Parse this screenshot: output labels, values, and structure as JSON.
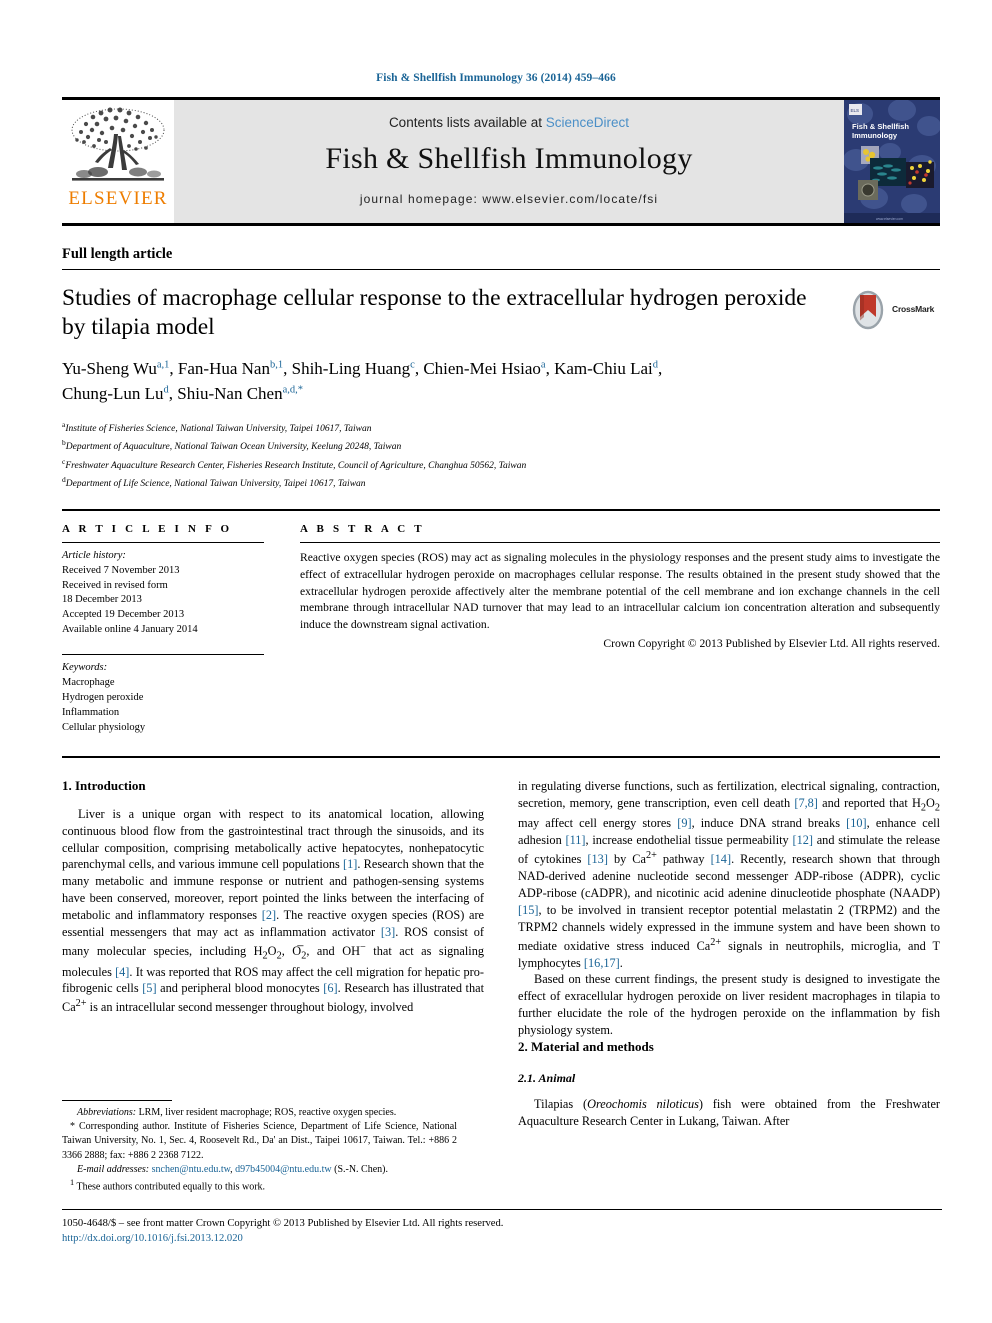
{
  "running_head": "Fish & Shellfish Immunology 36 (2014) 459–466",
  "masthead": {
    "publisher_name": "ELSEVIER",
    "contents_prefix": "Contents lists available at ",
    "sciencedirect": "ScienceDirect",
    "journal_title": "Fish & Shellfish Immunology",
    "homepage": "journal homepage: www.elsevier.com/locate/fsi",
    "cover_title_line1": "Fish & Shellfish",
    "cover_title_line2": "Immunology"
  },
  "article": {
    "type": "Full length article",
    "title": "Studies of macrophage cellular response to the extracellular hydrogen peroxide by tilapia model",
    "crossmark_label": "CrossMark",
    "authors_line1": "Yu-Sheng Wu",
    "authors": [
      {
        "name": "Yu-Sheng Wu",
        "sup": "a,1",
        "sep": ", "
      },
      {
        "name": "Fan-Hua Nan",
        "sup": "b,1",
        "sep": ", "
      },
      {
        "name": "Shih-Ling Huang",
        "sup": "c",
        "sep": ", "
      },
      {
        "name": "Chien-Mei Hsiao",
        "sup": "a",
        "sep": ", "
      },
      {
        "name": "Kam-Chiu Lai",
        "sup": "d",
        "sep": ","
      },
      {
        "name": "Chung-Lun Lu",
        "sup": "d",
        "sep": ", "
      },
      {
        "name": "Shiu-Nan Chen",
        "sup": "a,d,*",
        "sep": ""
      }
    ],
    "affiliations": [
      {
        "mark": "a",
        "text": "Institute of Fisheries Science, National Taiwan University, Taipei 10617, Taiwan"
      },
      {
        "mark": "b",
        "text": "Department of Aquaculture, National Taiwan Ocean University, Keelung 20248, Taiwan"
      },
      {
        "mark": "c",
        "text": "Freshwater Aquaculture Research Center, Fisheries Research Institute, Council of Agriculture, Changhua 50562, Taiwan"
      },
      {
        "mark": "d",
        "text": "Department of Life Science, National Taiwan University, Taipei 10617, Taiwan"
      }
    ]
  },
  "article_info": {
    "heading": "A R T I C L E   I N F O",
    "history_label": "Article history:",
    "history": [
      "Received 7 November 2013",
      "Received in revised form",
      "18 December 2013",
      "Accepted 19 December 2013",
      "Available online 4 January 2014"
    ],
    "keywords_label": "Keywords:",
    "keywords": [
      "Macrophage",
      "Hydrogen peroxide",
      "Inflammation",
      "Cellular physiology"
    ]
  },
  "abstract": {
    "heading": "A B S T R A C T",
    "text": "Reactive oxygen species (ROS) may act as signaling molecules in the physiology responses and the present study aims to investigate the effect of extracellular hydrogen peroxide on macrophages cellular response. The results obtained in the present study showed that the extracellular hydrogen peroxide affectively alter the membrane potential of the cell membrane and ion exchange channels in the cell membrane through intracellular NAD turnover that may lead to an intracellular calcium ion concentration alteration and subsequently induce the downstream signal activation.",
    "copyright": "Crown Copyright © 2013 Published by Elsevier Ltd. All rights reserved."
  },
  "body": {
    "intro_heading": "1. Introduction",
    "intro_p1_a": "Liver is a unique organ with respect to its anatomical location, allowing continuous blood flow from the gastrointestinal tract through the sinusoids, and its cellular composition, comprising metabolically active hepatocytes, nonhepatocytic parenchymal cells, and various immune cell populations ",
    "ref1": "[1]",
    "intro_p1_b": ". Research shown that the many metabolic and immune response or nutrient and pathogen-sensing systems have been conserved, moreover, report pointed the links between the interfacing of metabolic and inflammatory responses ",
    "ref2": "[2]",
    "intro_p1_c": ". The reactive oxygen species (ROS) are essential messengers that may act as inflammation activator ",
    "ref3": "[3]",
    "intro_p1_d": ". ROS consist of many molecular species, including H2O2, O2−, and OH− that act as signaling molecules ",
    "ref4": "[4]",
    "intro_p1_e": ". It was reported that ROS may affect the cell migration for hepatic pro-fibrogenic cells ",
    "ref5": "[5]",
    "intro_p1_f": " and peripheral blood monocytes ",
    "ref6": "[6]",
    "intro_p1_g": ". Research has illustrated that Ca2+ is an intracellular second messenger throughout biology, involved in regulating diverse functions, such as fertilization, electrical signaling, contraction, secretion, memory, gene transcription, even cell death ",
    "ref78": "[7,8]",
    "intro_p1_h": " and reported that H2O2 may affect cell energy stores ",
    "ref9": "[9]",
    "intro_p1_i": ", induce DNA strand breaks ",
    "ref10": "[10]",
    "intro_p1_j": ", enhance cell adhesion ",
    "ref11": "[11]",
    "intro_p1_k": ", increase endothelial tissue permeability ",
    "ref12": "[12]",
    "intro_p1_l": " and stimulate the release of cytokines ",
    "ref13": "[13]",
    "intro_p1_m": " by Ca2+ pathway ",
    "ref14": "[14]",
    "intro_p1_n": ". Recently, research shown that through NAD-derived adenine nucleotide second messenger ADP-ribose (ADPR), cyclic ADP-ribose (cADPR), and nicotinic acid adenine dinucleotide phosphate (NAADP) ",
    "ref15": "[15]",
    "intro_p1_o": ", to be involved in transient receptor potential melastatin 2 (TRPM2) and the TRPM2 channels widely expressed in the immune system and have been shown to mediate oxidative stress induced Ca2+ signals in neutrophils, microglia, and T lymphocytes ",
    "ref1617": "[16,17]",
    "intro_p1_p": ".",
    "intro_p2": "Based on these current findings, the present study is designed to investigate the effect of exracellular hydrogen peroxide on liver resident macrophages in tilapia to further elucidate the role of the hydrogen peroxide on the inflammation by fish physiology system.",
    "methods_heading": "2. Material and methods",
    "animal_heading": "2.1. Animal",
    "animal_p1": "Tilapias (Oreochomis niloticus) fish were obtained from the Freshwater Aquaculture Research Center in Lukang, Taiwan. After"
  },
  "footnotes": {
    "abbrev_label": "Abbreviations:",
    "abbrev_text": " LRM, liver resident macrophage; ROS, reactive oxygen species.",
    "corresponding": "* Corresponding author. Institute of Fisheries Science, Department of Life Science, National Taiwan University, No. 1, Sec. 4, Roosevelt Rd., Da' an Dist., Taipei 10617, Taiwan. Tel.: +886 2 3366 2888; fax: +886 2 2368 7122.",
    "email_label": "E-mail addresses:",
    "email1": "snchen@ntu.edu.tw",
    "email2": "d97b45004@ntu.edu.tw",
    "email_suffix": " (S.-N. Chen).",
    "equal_contrib_mark": "1",
    "equal_contrib": " These authors contributed equally to this work."
  },
  "bottom": {
    "issn_line": "1050-4648/$ – see front matter Crown Copyright © 2013 Published by Elsevier Ltd. All rights reserved.",
    "doi": "http://dx.doi.org/10.1016/j.fsi.2013.12.020"
  },
  "colors": {
    "link_blue": "#1a6496",
    "sd_blue": "#4b8fc7",
    "elsevier_orange": "#ee7d00",
    "cover_navy": "#2b3b73"
  }
}
